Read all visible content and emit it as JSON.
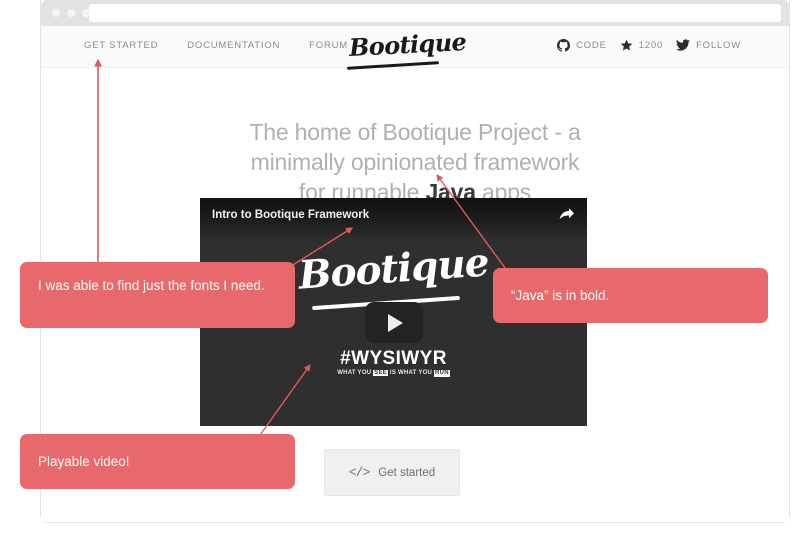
{
  "browser": {
    "window_dots": [
      "dot-red",
      "dot-yellow",
      "dot-green"
    ],
    "url_value": "",
    "url_placeholder": ""
  },
  "site": {
    "nav": [
      {
        "label": "GET STARTED",
        "name": "nav-get-started"
      },
      {
        "label": "DOCUMENTATION",
        "name": "nav-documentation"
      },
      {
        "label": "FORUM",
        "name": "nav-forum"
      }
    ],
    "brand": "Bootique",
    "social": [
      {
        "icon": "github-icon",
        "label": "CODE"
      },
      {
        "icon": "star-icon",
        "label": "1200"
      },
      {
        "icon": "twitter-icon",
        "label": "FOLLOW"
      }
    ]
  },
  "hero": {
    "line1": "The home of Bootique Project - a",
    "line2": "minimally opinionated framework",
    "line3_before": "for runnable ",
    "line3_bold": "Java",
    "line3_after": " apps"
  },
  "video": {
    "title": "Intro to Bootique Framework",
    "share_icon": "share-arrow-icon",
    "brand": "Bootique",
    "play_icon": "play-icon",
    "hashtag": "#WYSIWYR",
    "tagline_parts": [
      "WHAT YOU ",
      "SEE",
      " IS WHAT YOU ",
      "RUN"
    ]
  },
  "cta": {
    "icon": "code-brackets-icon",
    "label": "Get started"
  },
  "annotations": [
    {
      "name": "callout-fonts",
      "text": "I was able to find just the fonts I need.",
      "points_to": "nav-get-started"
    },
    {
      "name": "callout-java",
      "text": "“Java” is in bold.",
      "points_to": "hero-bold-java"
    },
    {
      "name": "callout-video",
      "text": "Playable video!",
      "points_to": "video-player"
    }
  ],
  "colors": {
    "callout_red": "#e8696c",
    "arrow_red": "#e05a5d",
    "video_dark": "#2f2f2f",
    "hero_gray": "#b0b0b0",
    "chrome_gray": "#e2e2e2"
  }
}
